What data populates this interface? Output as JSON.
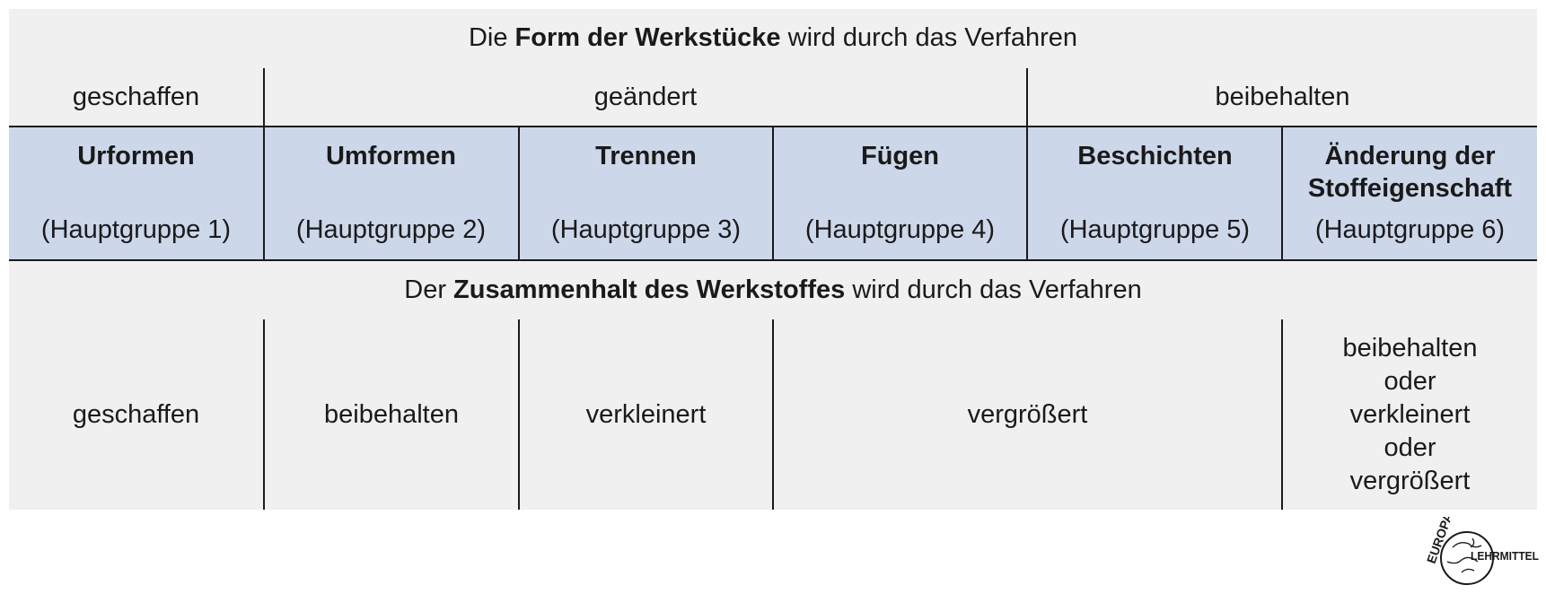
{
  "top_heading": {
    "prefix": "Die ",
    "bold": "Form der Werkstücke",
    "suffix": " wird durch das Verfahren"
  },
  "form_effects": {
    "created": "geschaffen",
    "changed": "geändert",
    "retained": "beibehalten"
  },
  "main_groups": [
    {
      "name": "Urformen",
      "group": "(Hauptgruppe 1)"
    },
    {
      "name": "Umformen",
      "group": "(Hauptgruppe 2)"
    },
    {
      "name": "Trennen",
      "group": "(Hauptgruppe 3)"
    },
    {
      "name": "Fügen",
      "group": "(Hauptgruppe 4)"
    },
    {
      "name": "Beschichten",
      "group": "(Hauptgruppe 5)"
    },
    {
      "name_line1": "Änderung der",
      "name_line2": "Stoffeigenschaft",
      "group": "(Hauptgruppe 6)"
    }
  ],
  "bottom_heading": {
    "prefix": "Der ",
    "bold": "Zusammenhalt des Werkstoffes",
    "suffix": " wird durch das Verfahren"
  },
  "cohesion_effects": {
    "created": "geschaffen",
    "retained": "beibehalten",
    "reduced": "verkleinert",
    "increased": "vergrößert",
    "mixed": [
      "beibehalten",
      "oder",
      "verkleinert",
      "oder",
      "vergrößert"
    ]
  },
  "logo": {
    "text_top": "EUROPA",
    "text_side": "LEHRMITTEL"
  },
  "colors": {
    "panel": "#f0f0f0",
    "highlight": "#cdd7ea",
    "lines": "#1a1a1a"
  }
}
